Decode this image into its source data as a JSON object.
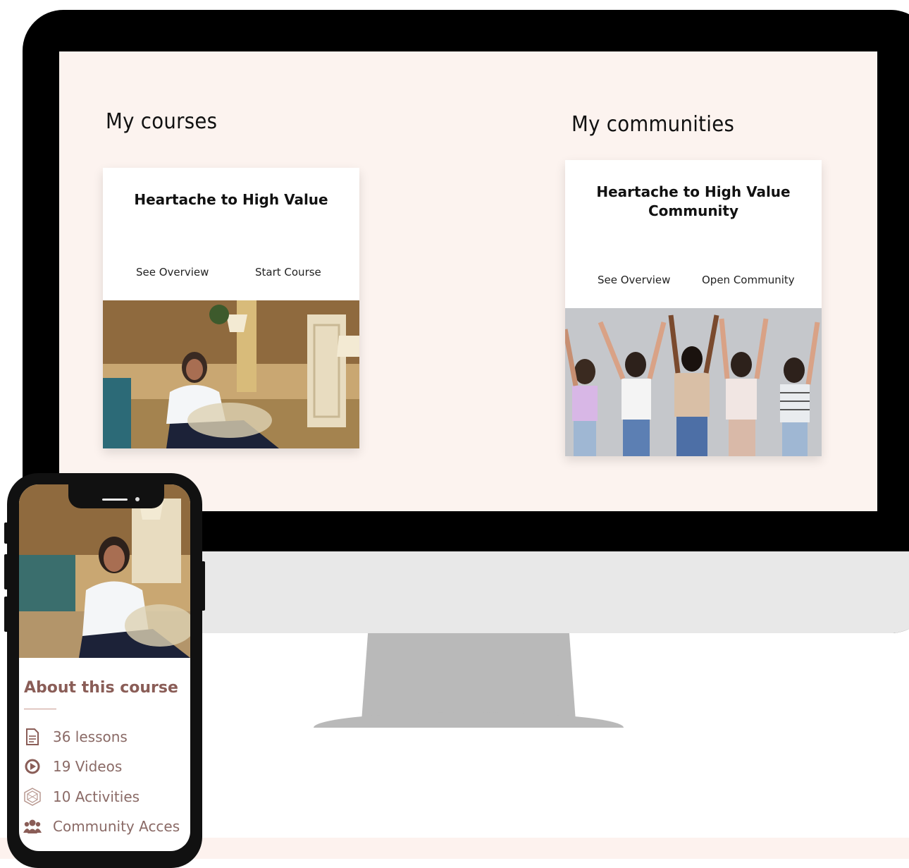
{
  "desktop": {
    "courses_heading": "My courses",
    "communities_heading": "My communities",
    "course_card": {
      "title": "Heartache to High Value",
      "overview_label": "See Overview",
      "start_label": "Start Course"
    },
    "community_card": {
      "title_line1": "Heartache to High Value",
      "title_line2": "Community",
      "overview_label": "See Overview",
      "open_label": "Open Community"
    }
  },
  "mobile": {
    "about_title": "About this course",
    "stats": [
      {
        "icon": "document-icon",
        "label": "36 lessons"
      },
      {
        "icon": "play-circle-icon",
        "label": "19 Videos"
      },
      {
        "icon": "hexagon-icon",
        "label": "10 Activities"
      },
      {
        "icon": "users-icon",
        "label": "Community Acces"
      }
    ]
  },
  "colors": {
    "screen_bg": "#fcf3ef",
    "accent_brown": "#8a5d57",
    "stat_text": "#8a6a66"
  }
}
